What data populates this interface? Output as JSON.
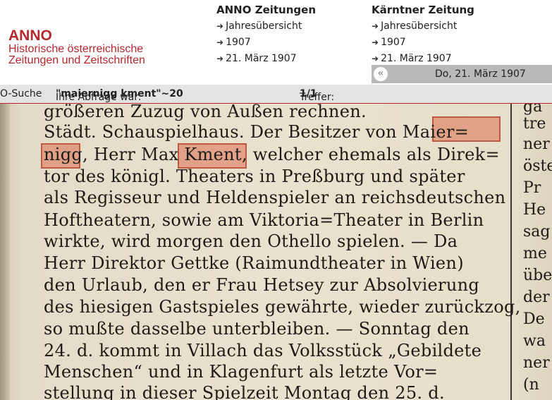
{
  "logo": {
    "title": "ANNO",
    "subtitle_line1": "Historische österreichische",
    "subtitle_line2": "Zeitungen und Zeitschriften"
  },
  "nav": {
    "col1": {
      "heading": "ANNO Zeitungen",
      "links": [
        "Jahresübersicht",
        "1907",
        "21. März 1907"
      ]
    },
    "col2": {
      "heading": "Kärntner Zeitung",
      "links": [
        "Jahresübersicht",
        "1907",
        "21. März 1907"
      ]
    }
  },
  "datebar": {
    "back_icon": "double-chevron-left-icon",
    "date": "Do, 21. März 1907"
  },
  "search": {
    "label": "O-Suche",
    "query_prefix": "Ihre Abfrage war:",
    "query": "\"maiernigg kment\"~20",
    "hits_label": "Treffer:",
    "hits": "1/1"
  },
  "scan": {
    "lines": [
      "größeren Zuzug von Außen rechnen.",
      "Städt. Schauspielhaus. Der Besitzer von Maier=",
      "nigg, Herr Max Kment, welcher ehemals als Direk=",
      "tor des königl. Theaters in Preßburg und später",
      "als Regisseur und Heldenspieler an reichsdeutschen",
      "Hoftheatern, sowie am Viktoria=Theater in Berlin",
      "wirkte, wird morgen den Othello spielen. — Da",
      "Herr Direktor Gettke (Raimundtheater in Wien)",
      "den Urlaub, den er Frau Hetsey zur Absolvierung",
      "des hiesigen Gastspieles gewährte, wieder zurückzog,",
      "so mußte dasselbe unterbleiben. — Sonntag den",
      "24. d. kommt in Villach das Volksstück „Gebildete",
      "Menschen“ und in Klagenfurt als letzte Vor=",
      "stellung in dieser Spielzeit Montag den 25. d."
    ],
    "right_column": [
      "gä",
      "tre",
      "ner",
      "öste",
      "Pr",
      "He",
      "sag",
      "me",
      "übe",
      "der",
      "De",
      "wa",
      "ner",
      "(n"
    ],
    "highlight_color": "#dc6e50"
  }
}
